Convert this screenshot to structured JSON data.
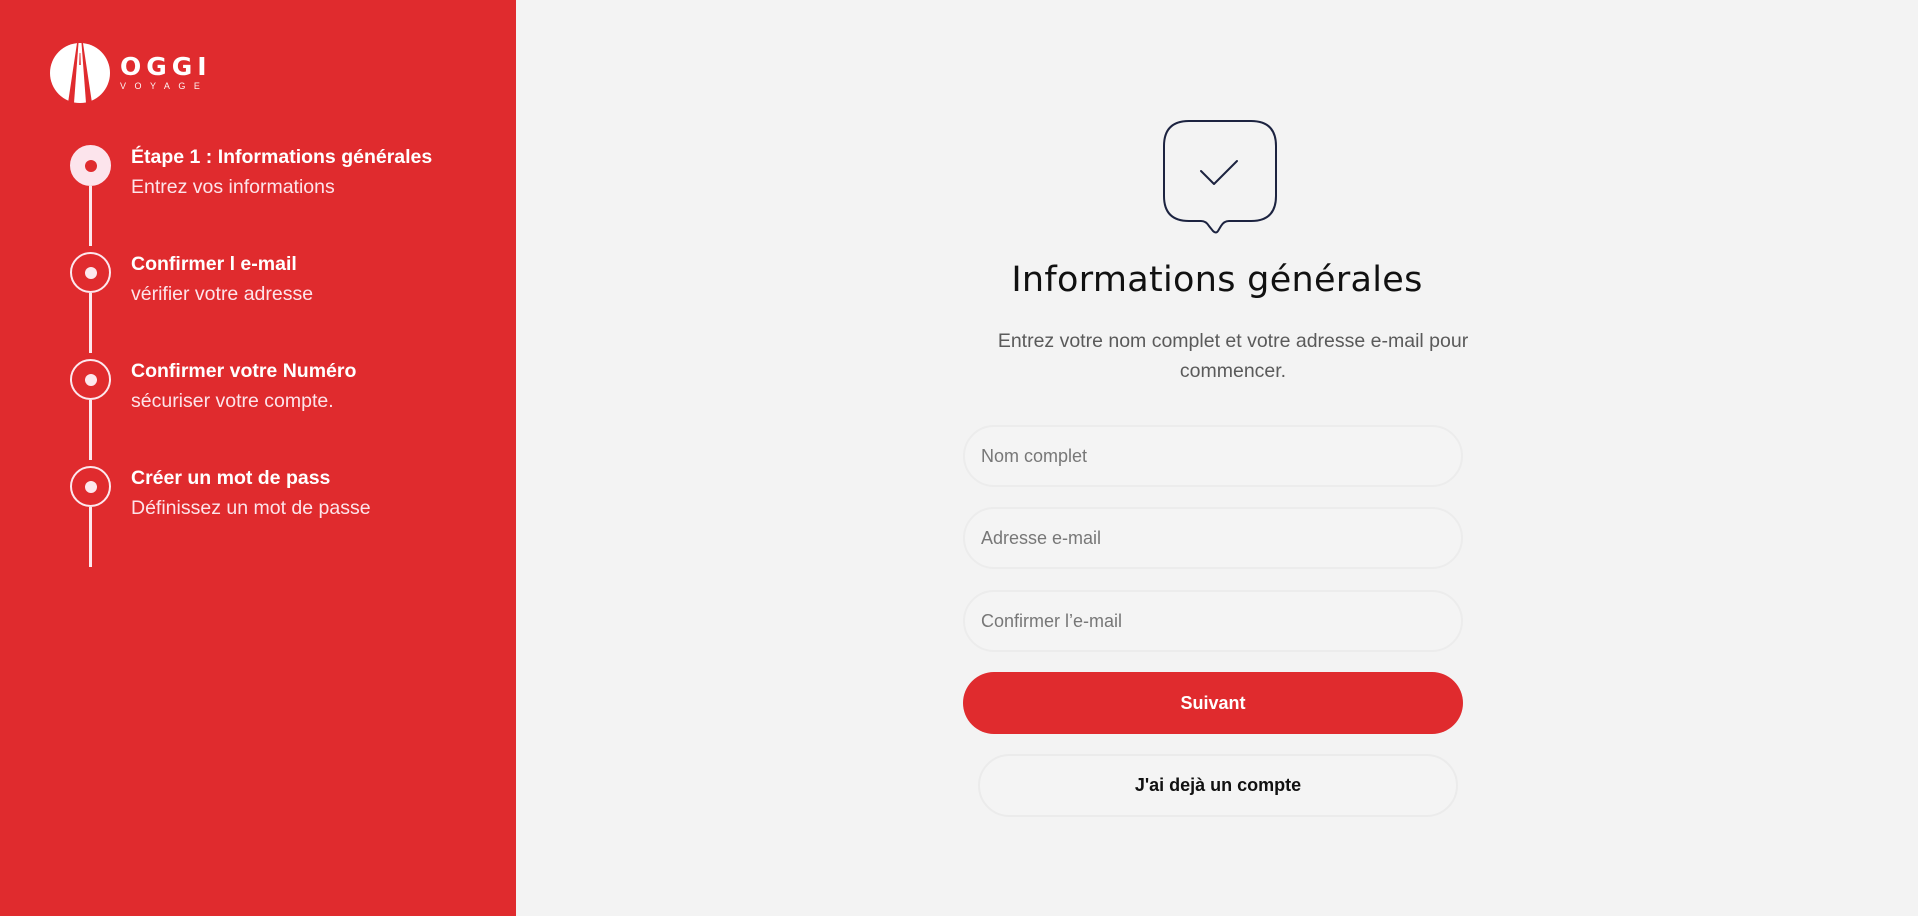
{
  "brand": {
    "name": "OGGI",
    "tagline": "VOYAGE",
    "logo_icon": "road-logo-icon",
    "primary_color": "#e02b2e"
  },
  "steps": [
    {
      "title": "Étape 1 : Informations générales",
      "subtitle": "Entrez vos informations",
      "active": true
    },
    {
      "title": "Confirmer l e-mail",
      "subtitle": "vérifier votre adresse",
      "active": false
    },
    {
      "title": "Confirmer votre Numéro",
      "subtitle": "sécuriser votre compte.",
      "active": false
    },
    {
      "title": "Créer un mot de pass",
      "subtitle": "Définissez un mot de passe",
      "active": false
    }
  ],
  "form": {
    "icon": "check-bubble-icon",
    "title": "Informations générales",
    "subtitle": "Entrez votre nom complet et votre adresse e-mail pour commencer.",
    "fields": {
      "full_name": {
        "placeholder": "Nom complet",
        "value": ""
      },
      "email": {
        "placeholder": "Adresse e-mail",
        "value": ""
      },
      "confirm_email": {
        "placeholder": "Confirmer l’e-mail",
        "value": ""
      }
    },
    "next_label": "Suivant",
    "login_label": "J'ai dejà un compte"
  }
}
